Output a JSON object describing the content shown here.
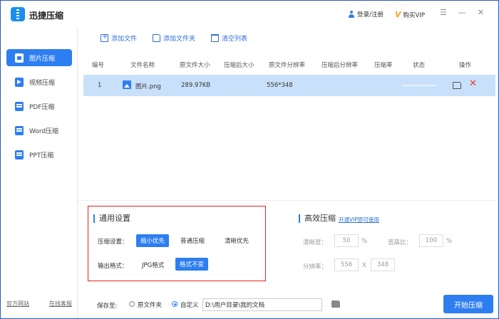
{
  "app": {
    "title": "迅捷压缩"
  },
  "header": {
    "login_label": "登录/注册",
    "vip_label": "购买VIP",
    "menu_glyph": "☰",
    "minimize_glyph": "—",
    "close_glyph": "✕"
  },
  "sidebar": {
    "items": [
      {
        "label": "图片压缩",
        "icon": "image-icon"
      },
      {
        "label": "视频压缩",
        "icon": "video-icon"
      },
      {
        "label": "PDF压缩",
        "icon": "pdf-icon"
      },
      {
        "label": "Word压缩",
        "icon": "word-icon"
      },
      {
        "label": "PPT压缩",
        "icon": "ppt-icon"
      }
    ],
    "footer": {
      "website": "官方网站",
      "support": "在线客服"
    }
  },
  "toolbar": {
    "add_file": "添加文件",
    "add_folder": "添加文件夹",
    "clear_list": "清空列表"
  },
  "table": {
    "columns": [
      "编号",
      "文件名称",
      "原文件大小",
      "压缩后大小",
      "原文件分辨率",
      "压缩后分辨率",
      "压缩率",
      "状态",
      "操作"
    ],
    "rows": [
      {
        "index": "1",
        "name": "图片.png",
        "original_size": "289.97KB",
        "compressed_size": "",
        "original_resolution": "556*348",
        "compressed_resolution": "",
        "ratio": "",
        "status": ""
      }
    ]
  },
  "settings": {
    "title": "通用设置",
    "compress_label": "压缩设置：",
    "compress_options": [
      "缩小优先",
      "普通压缩",
      "清晰优先"
    ],
    "compress_selected": "缩小优先",
    "format_label": "输出格式：",
    "format_options": [
      "JPG格式",
      "格式不变"
    ],
    "format_selected": "格式不变"
  },
  "efficient": {
    "title": "高效压缩",
    "vip_link": "开通VIP即可使用",
    "clarity_label": "清晰度：",
    "clarity_value": "50",
    "clarity_unit": "%",
    "ratio_label": "宽高比：",
    "ratio_value": "100",
    "ratio_unit": "%",
    "resolution_label": "分辨率：",
    "width_value": "556",
    "separator": "X",
    "height_value": "348"
  },
  "save": {
    "label": "保存至:",
    "option_original": "原文件夹",
    "option_custom": "自定义",
    "path": "D:\\用户目录\\我的文档",
    "start_button": "开始压缩"
  },
  "colors": {
    "accent": "#2d7ef0",
    "row_highlight": "#c9e0fb",
    "highlight_box": "#e32222"
  }
}
